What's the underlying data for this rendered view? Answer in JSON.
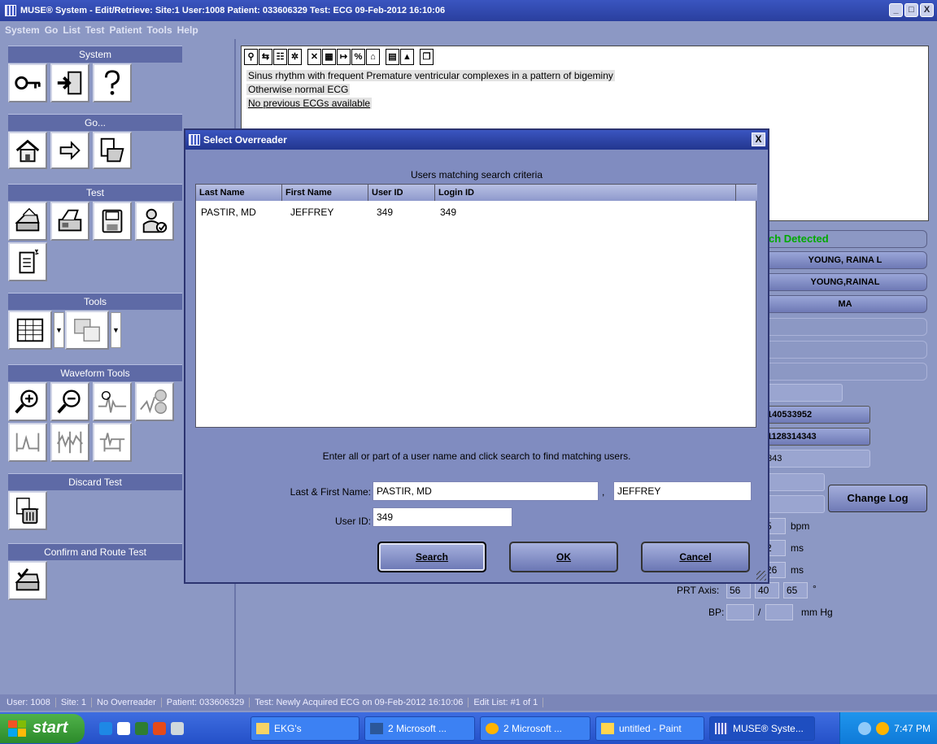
{
  "window": {
    "title": "MUSE® System - Edit/Retrieve: Site:1 User:1008  Patient: 033606329  Test: ECG 09-Feb-2012 16:10:06",
    "controls": [
      "_",
      "□",
      "X"
    ]
  },
  "menu": [
    "System",
    "Go",
    "List",
    "Test",
    "Patient",
    "Tools",
    "Help"
  ],
  "sections": {
    "system": "System",
    "go": "Go...",
    "test": "Test",
    "tools": "Tools",
    "waveform": "Waveform Tools",
    "discard": "Discard Test",
    "confirm": "Confirm and Route Test"
  },
  "report": {
    "lines": [
      "Sinus rhythm with frequent Premature ventricular complexes in a pattern of bigeminy",
      "Otherwise normal ECG",
      "No previous ECGs available"
    ]
  },
  "patient": {
    "detected": "ch Detected",
    "field1": "YOUNG, RAINA L",
    "field2": "YOUNG,RAINAL",
    "field3": "MA",
    "id1": "140533952",
    "id2": "1128314343",
    "id3": "343"
  },
  "change_log": "Change Log",
  "vitals": {
    "bpm_value": "5",
    "bpm_unit": "bpm",
    "ms1_value": "2",
    "ms1_unit": "ms",
    "ms2_value": "26",
    "ms2_unit": "ms",
    "prt_label": "PRT Axis:",
    "prt_p": "56",
    "prt_r": "40",
    "prt_t": "65",
    "deg": "°",
    "bp_label": "BP:",
    "bp_sep": "/",
    "bp_unit": "mm Hg"
  },
  "dialog": {
    "title": "Select Overreader",
    "close": "X",
    "criteria": "Users matching search criteria",
    "columns": [
      "Last Name",
      "First Name",
      "User ID",
      "Login ID"
    ],
    "rows": [
      [
        "PASTIR, MD",
        "JEFFREY",
        "349",
        "349"
      ]
    ],
    "hint": "Enter all or part of a user name and click search to find matching users.",
    "name_label": "Last & First Name:",
    "last_name": "PASTIR, MD",
    "comma": ",",
    "first_name": "JEFFREY",
    "userid_label": "User ID:",
    "userid": "349",
    "search": "Search",
    "ok": "OK",
    "cancel": "Cancel"
  },
  "status": [
    "User: 1008",
    "Site: 1",
    "No Overreader",
    "Patient: 033606329",
    "Test: Newly Acquired ECG on 09-Feb-2012 16:10:06",
    "Edit List: #1 of 1"
  ],
  "taskbar": {
    "start": "start",
    "tasks": [
      "EKG's",
      "2 Microsoft ...",
      "2 Microsoft ...",
      "untitled - Paint",
      "MUSE® Syste..."
    ],
    "clock": "7:47 PM"
  },
  "colors": {
    "panel": "#8c98c4",
    "accent": "#3a55c0",
    "detected": "#00aa00"
  }
}
